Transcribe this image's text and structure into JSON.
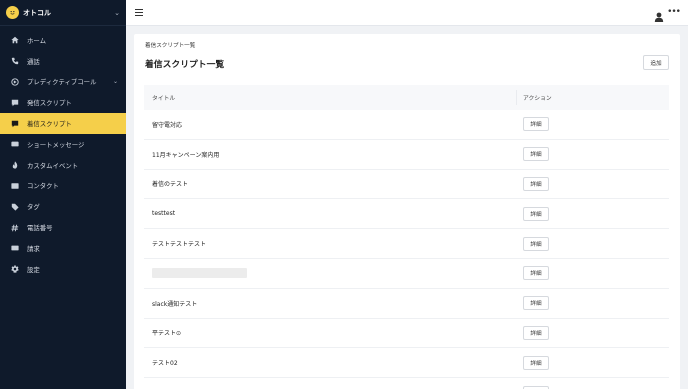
{
  "brand": {
    "name": "オトコル"
  },
  "sidebar": {
    "items": [
      {
        "label": "ホーム",
        "icon": "home-icon"
      },
      {
        "label": "通話",
        "icon": "phone-icon"
      },
      {
        "label": "プレディクティブコール",
        "icon": "predictive-call-icon",
        "expandable": true
      },
      {
        "label": "発信スクリプト",
        "icon": "outgoing-script-icon"
      },
      {
        "label": "着信スクリプト",
        "icon": "incoming-script-icon",
        "active": true
      },
      {
        "label": "ショートメッセージ",
        "icon": "sms-icon"
      },
      {
        "label": "カスタムイベント",
        "icon": "fire-icon"
      },
      {
        "label": "コンタクト",
        "icon": "contact-card-icon"
      },
      {
        "label": "タグ",
        "icon": "tag-icon"
      },
      {
        "label": "電話番号",
        "icon": "hash-icon"
      },
      {
        "label": "請求",
        "icon": "credit-card-icon"
      },
      {
        "label": "設定",
        "icon": "gear-icon"
      }
    ]
  },
  "page": {
    "breadcrumb": "着信スクリプト一覧",
    "title": "着信スクリプト一覧",
    "add_label": "追加"
  },
  "table": {
    "columns": [
      "タイトル",
      "アクション"
    ],
    "detail_label": "詳細",
    "rows": [
      {
        "title": "留守電対応"
      },
      {
        "title": "11月キャンペーン案内用"
      },
      {
        "title": "着信のテスト"
      },
      {
        "title": "testtest"
      },
      {
        "title": "テストテストテスト"
      },
      {
        "title": "",
        "redacted": true
      },
      {
        "title": "slack通知テスト"
      },
      {
        "title": "平テスト⊙"
      },
      {
        "title": "テスト02"
      },
      {
        "title": ""
      }
    ]
  },
  "colors": {
    "sidebar_bg": "#0f1a2b",
    "accent": "#f5cf4a"
  }
}
